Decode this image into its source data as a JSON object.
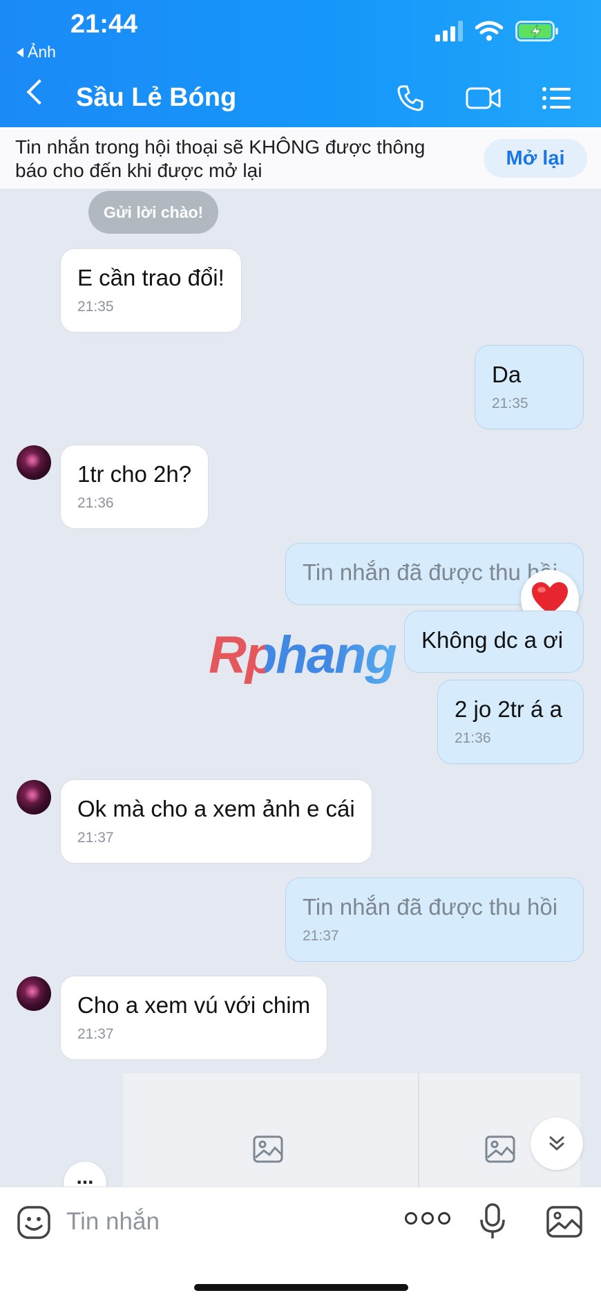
{
  "status_bar": {
    "time": "21:44",
    "back_app": "Ảnh"
  },
  "header": {
    "title": "Sầu Lẻ Bóng"
  },
  "notice": {
    "text": "Tin nhắn trong hội thoại sẽ KHÔNG được thông báo cho đến khi được mở lại",
    "button": "Mở lại"
  },
  "greeting": "Gửi lời chào!",
  "messages": [
    {
      "direction": "in",
      "text": "E cần trao đổi!",
      "time": "21:35"
    },
    {
      "direction": "out",
      "text": "Da",
      "time": "21:35"
    },
    {
      "direction": "in",
      "text": "1tr cho 2h?",
      "time": "21:36"
    },
    {
      "direction": "out",
      "text": "Tin nhắn đã được thu hồi",
      "time": ""
    },
    {
      "direction": "out",
      "text": "Không dc a ơi",
      "time": ""
    },
    {
      "direction": "out",
      "text": "2 jo 2tr á a",
      "time": "21:36"
    },
    {
      "direction": "in",
      "text": "Ok mà cho a xem ảnh e cái",
      "time": "21:37"
    },
    {
      "direction": "out",
      "text": "Tin nhắn đã được thu hồi",
      "time": "21:37"
    },
    {
      "direction": "in",
      "text": "Cho a xem vú với chim",
      "time": "21:37"
    }
  ],
  "watermark": "Rphang",
  "more_indicator": "...",
  "input": {
    "placeholder": "Tin nhắn"
  },
  "icons": [
    "back-arrow-icon",
    "phone-icon",
    "video-call-icon",
    "menu-list-icon",
    "heart-icon",
    "image-icon",
    "chevron-down-icon",
    "emoji-icon",
    "more-icon",
    "mic-icon",
    "gallery-icon"
  ],
  "colors": {
    "header": "#1597f9",
    "outgoing_bubble": "#d6ecfd",
    "incoming_bubble": "#ffffff",
    "chat_bg": "#e4e8f1",
    "accent": "#1876e8"
  }
}
